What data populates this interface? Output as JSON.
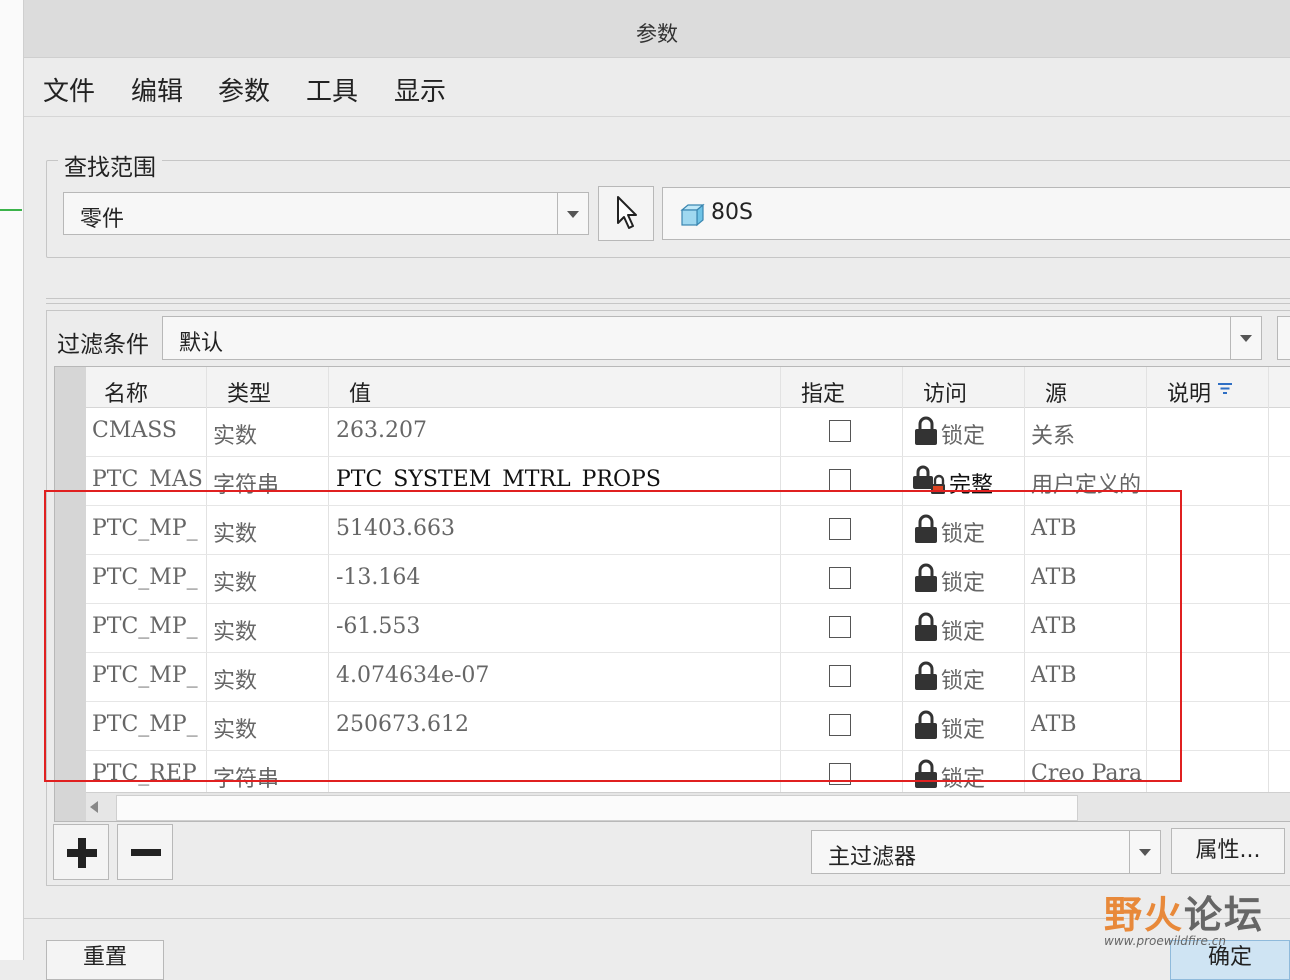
{
  "window": {
    "title": "参数"
  },
  "menu": [
    "文件",
    "编辑",
    "参数",
    "工具",
    "显示"
  ],
  "search": {
    "legend": "查找范围",
    "scope_value": "零件",
    "model_name": "80S"
  },
  "filter": {
    "label": "过滤条件",
    "value": "默认"
  },
  "table": {
    "columns": [
      "名称",
      "类型",
      "值",
      "指定",
      "访问",
      "源",
      "说明"
    ],
    "rows": [
      {
        "name": "CMASS",
        "type": "实数",
        "value": "263.207",
        "designate": false,
        "access": "锁定",
        "access_icon": "lock-icon",
        "source": "关系"
      },
      {
        "name": "PTC_MAS",
        "type": "字符串",
        "value": "PTC_SYSTEM_MTRL_PROPS",
        "designate": false,
        "access": "完整",
        "access_icon": "unlock-icon",
        "source": "用户定义的"
      },
      {
        "name": "PTC_MP_",
        "type": "实数",
        "value": "51403.663",
        "designate": false,
        "access": "锁定",
        "access_icon": "lock-icon",
        "source": "ATB"
      },
      {
        "name": "PTC_MP_",
        "type": "实数",
        "value": "-13.164",
        "designate": false,
        "access": "锁定",
        "access_icon": "lock-icon",
        "source": "ATB"
      },
      {
        "name": "PTC_MP_",
        "type": "实数",
        "value": "-61.553",
        "designate": false,
        "access": "锁定",
        "access_icon": "lock-icon",
        "source": "ATB"
      },
      {
        "name": "PTC_MP_",
        "type": "实数",
        "value": "4.074634e-07",
        "designate": false,
        "access": "锁定",
        "access_icon": "lock-icon",
        "source": "ATB"
      },
      {
        "name": "PTC_MP_",
        "type": "实数",
        "value": "250673.612",
        "designate": false,
        "access": "锁定",
        "access_icon": "lock-icon",
        "source": "ATB"
      },
      {
        "name": "PTC_REP",
        "type": "字符串",
        "value": "",
        "designate": false,
        "access": "锁定",
        "access_icon": "lock-icon",
        "source": "Creo Para"
      }
    ]
  },
  "toolbar": {
    "main_filter": "主过滤器",
    "properties_label": "属性..."
  },
  "dialog_buttons": {
    "reset": "重置",
    "ok": "确定"
  },
  "watermark": {
    "title_part1": "野火",
    "title_part2": "论坛",
    "url": "www.proewildfire.cn"
  },
  "colors": {
    "highlight": "#e02020",
    "row_text": "#666666",
    "accent_filter_icon": "#2f6fc4"
  }
}
